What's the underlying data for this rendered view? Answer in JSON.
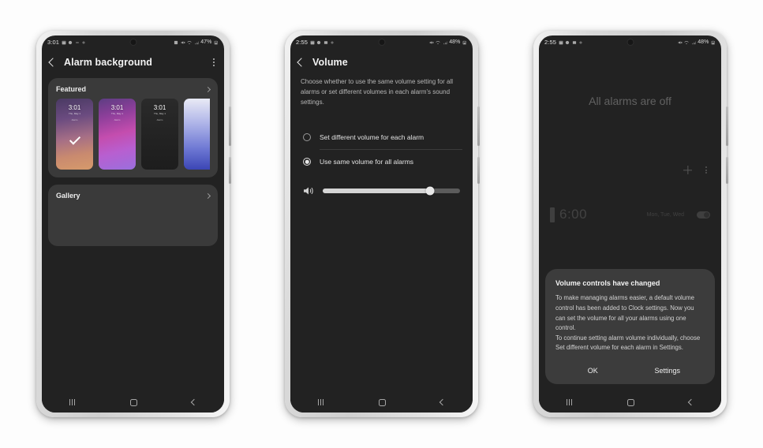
{
  "phones": [
    {
      "id": "phone-1",
      "status": {
        "time": "3:01",
        "battery": "47%",
        "left_icons": [
          "calendar-icon",
          "record-icon",
          "dnd-icon",
          "plus-icon"
        ],
        "right_icons": [
          "alarm-icon",
          "mute-icon",
          "wifi-icon",
          "signal-icon",
          "battery-icon"
        ]
      },
      "header": {
        "title": "Alarm background",
        "back": "back-arrow",
        "menu": "more-options"
      },
      "featured": {
        "label": "Featured",
        "chevron": "chevron-right",
        "thumbs": [
          {
            "time": "3:01",
            "sub": "Thu, May 1",
            "sub2": "Alarm",
            "selected": true,
            "style": "purple-orange"
          },
          {
            "time": "3:01",
            "sub": "Thu, May 1",
            "sub2": "Alarm",
            "selected": false,
            "style": "magenta"
          },
          {
            "time": "3:01",
            "sub": "Thu, May 1",
            "sub2": "Alarm",
            "selected": false,
            "style": "black"
          },
          {
            "time": "",
            "sub": "",
            "sub2": "",
            "selected": false,
            "style": "blue"
          }
        ]
      },
      "gallery": {
        "label": "Gallery",
        "chevron": "chevron-right"
      }
    },
    {
      "id": "phone-2",
      "status": {
        "time": "2:55",
        "battery": "48%",
        "left_icons": [
          "calendar-icon",
          "record-icon",
          "dnd-icon",
          "plus-icon"
        ],
        "right_icons": [
          "mute-icon",
          "wifi-icon",
          "signal-icon",
          "battery-icon"
        ]
      },
      "header": {
        "title": "Volume",
        "back": "back-arrow"
      },
      "description": "Choose whether to use the same volume setting for all alarms or set different volumes in each alarm's sound settings.",
      "options": [
        {
          "label": "Set different volume for each alarm",
          "selected": false
        },
        {
          "label": "Use same volume for all alarms",
          "selected": true
        }
      ],
      "slider": {
        "icon": "speaker-icon",
        "value": 78
      }
    },
    {
      "id": "phone-3",
      "status": {
        "time": "2:55",
        "battery": "48%",
        "left_icons": [
          "calendar-icon",
          "record-icon",
          "dnd-icon",
          "plus-icon"
        ],
        "right_icons": [
          "mute-icon",
          "wifi-icon",
          "signal-icon",
          "battery-icon"
        ]
      },
      "empty_state": "All alarms are off",
      "ghost": {
        "time": "6:00",
        "days": "Mon, Tue, Wed"
      },
      "dialog": {
        "title": "Volume controls have changed",
        "body": "To make managing alarms easier, a default volume control has been added to Clock settings. Now you can set the volume for all your alarms using one control.\nTo continue setting alarm volume individually, choose Set different volume for each alarm in Settings.",
        "buttons": {
          "ok": "OK",
          "settings": "Settings"
        }
      }
    }
  ],
  "navbar": {
    "recents": "recents-icon",
    "home": "home-icon",
    "back": "back-icon"
  },
  "colors": {
    "screen_bg": "#222222",
    "card_bg": "#3a3a3a",
    "dialog_bg": "#3c3c3c",
    "accent_text": "#f2f2f2"
  }
}
